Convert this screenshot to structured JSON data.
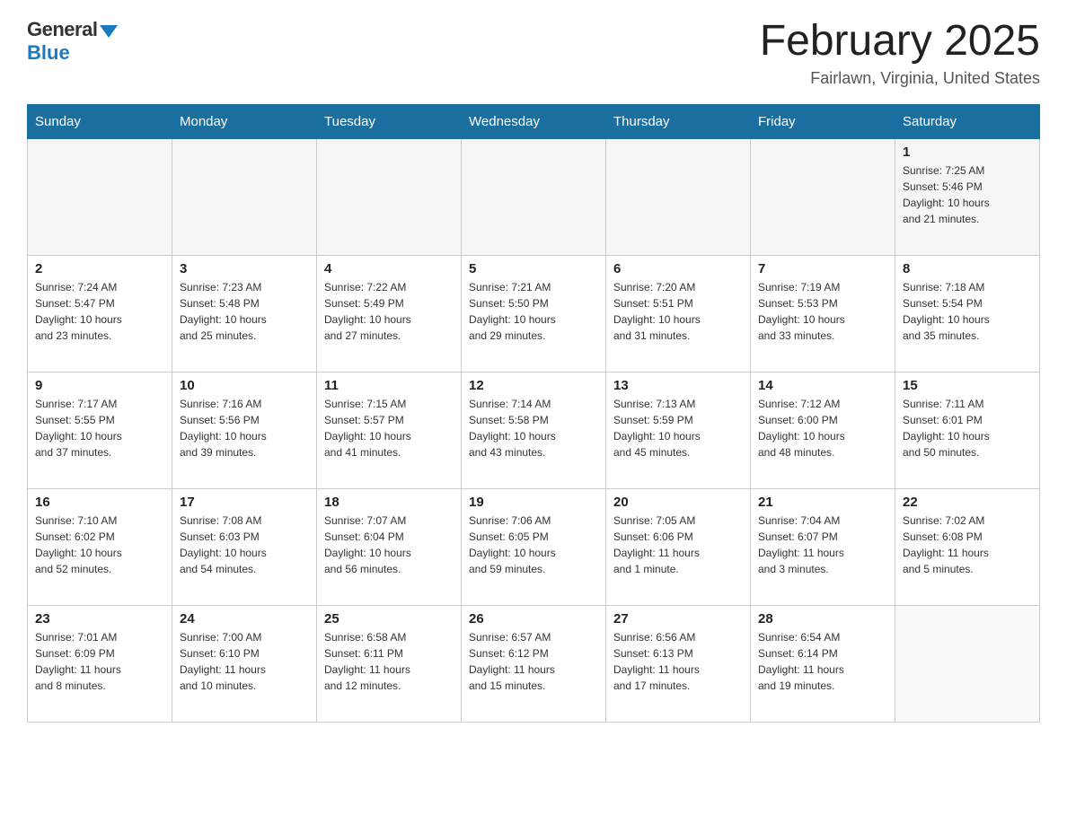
{
  "logo": {
    "general": "General",
    "blue": "Blue"
  },
  "title": "February 2025",
  "location": "Fairlawn, Virginia, United States",
  "days_of_week": [
    "Sunday",
    "Monday",
    "Tuesday",
    "Wednesday",
    "Thursday",
    "Friday",
    "Saturday"
  ],
  "weeks": [
    [
      {
        "day": "",
        "info": ""
      },
      {
        "day": "",
        "info": ""
      },
      {
        "day": "",
        "info": ""
      },
      {
        "day": "",
        "info": ""
      },
      {
        "day": "",
        "info": ""
      },
      {
        "day": "",
        "info": ""
      },
      {
        "day": "1",
        "info": "Sunrise: 7:25 AM\nSunset: 5:46 PM\nDaylight: 10 hours\nand 21 minutes."
      }
    ],
    [
      {
        "day": "2",
        "info": "Sunrise: 7:24 AM\nSunset: 5:47 PM\nDaylight: 10 hours\nand 23 minutes."
      },
      {
        "day": "3",
        "info": "Sunrise: 7:23 AM\nSunset: 5:48 PM\nDaylight: 10 hours\nand 25 minutes."
      },
      {
        "day": "4",
        "info": "Sunrise: 7:22 AM\nSunset: 5:49 PM\nDaylight: 10 hours\nand 27 minutes."
      },
      {
        "day": "5",
        "info": "Sunrise: 7:21 AM\nSunset: 5:50 PM\nDaylight: 10 hours\nand 29 minutes."
      },
      {
        "day": "6",
        "info": "Sunrise: 7:20 AM\nSunset: 5:51 PM\nDaylight: 10 hours\nand 31 minutes."
      },
      {
        "day": "7",
        "info": "Sunrise: 7:19 AM\nSunset: 5:53 PM\nDaylight: 10 hours\nand 33 minutes."
      },
      {
        "day": "8",
        "info": "Sunrise: 7:18 AM\nSunset: 5:54 PM\nDaylight: 10 hours\nand 35 minutes."
      }
    ],
    [
      {
        "day": "9",
        "info": "Sunrise: 7:17 AM\nSunset: 5:55 PM\nDaylight: 10 hours\nand 37 minutes."
      },
      {
        "day": "10",
        "info": "Sunrise: 7:16 AM\nSunset: 5:56 PM\nDaylight: 10 hours\nand 39 minutes."
      },
      {
        "day": "11",
        "info": "Sunrise: 7:15 AM\nSunset: 5:57 PM\nDaylight: 10 hours\nand 41 minutes."
      },
      {
        "day": "12",
        "info": "Sunrise: 7:14 AM\nSunset: 5:58 PM\nDaylight: 10 hours\nand 43 minutes."
      },
      {
        "day": "13",
        "info": "Sunrise: 7:13 AM\nSunset: 5:59 PM\nDaylight: 10 hours\nand 45 minutes."
      },
      {
        "day": "14",
        "info": "Sunrise: 7:12 AM\nSunset: 6:00 PM\nDaylight: 10 hours\nand 48 minutes."
      },
      {
        "day": "15",
        "info": "Sunrise: 7:11 AM\nSunset: 6:01 PM\nDaylight: 10 hours\nand 50 minutes."
      }
    ],
    [
      {
        "day": "16",
        "info": "Sunrise: 7:10 AM\nSunset: 6:02 PM\nDaylight: 10 hours\nand 52 minutes."
      },
      {
        "day": "17",
        "info": "Sunrise: 7:08 AM\nSunset: 6:03 PM\nDaylight: 10 hours\nand 54 minutes."
      },
      {
        "day": "18",
        "info": "Sunrise: 7:07 AM\nSunset: 6:04 PM\nDaylight: 10 hours\nand 56 minutes."
      },
      {
        "day": "19",
        "info": "Sunrise: 7:06 AM\nSunset: 6:05 PM\nDaylight: 10 hours\nand 59 minutes."
      },
      {
        "day": "20",
        "info": "Sunrise: 7:05 AM\nSunset: 6:06 PM\nDaylight: 11 hours\nand 1 minute."
      },
      {
        "day": "21",
        "info": "Sunrise: 7:04 AM\nSunset: 6:07 PM\nDaylight: 11 hours\nand 3 minutes."
      },
      {
        "day": "22",
        "info": "Sunrise: 7:02 AM\nSunset: 6:08 PM\nDaylight: 11 hours\nand 5 minutes."
      }
    ],
    [
      {
        "day": "23",
        "info": "Sunrise: 7:01 AM\nSunset: 6:09 PM\nDaylight: 11 hours\nand 8 minutes."
      },
      {
        "day": "24",
        "info": "Sunrise: 7:00 AM\nSunset: 6:10 PM\nDaylight: 11 hours\nand 10 minutes."
      },
      {
        "day": "25",
        "info": "Sunrise: 6:58 AM\nSunset: 6:11 PM\nDaylight: 11 hours\nand 12 minutes."
      },
      {
        "day": "26",
        "info": "Sunrise: 6:57 AM\nSunset: 6:12 PM\nDaylight: 11 hours\nand 15 minutes."
      },
      {
        "day": "27",
        "info": "Sunrise: 6:56 AM\nSunset: 6:13 PM\nDaylight: 11 hours\nand 17 minutes."
      },
      {
        "day": "28",
        "info": "Sunrise: 6:54 AM\nSunset: 6:14 PM\nDaylight: 11 hours\nand 19 minutes."
      },
      {
        "day": "",
        "info": ""
      }
    ]
  ]
}
